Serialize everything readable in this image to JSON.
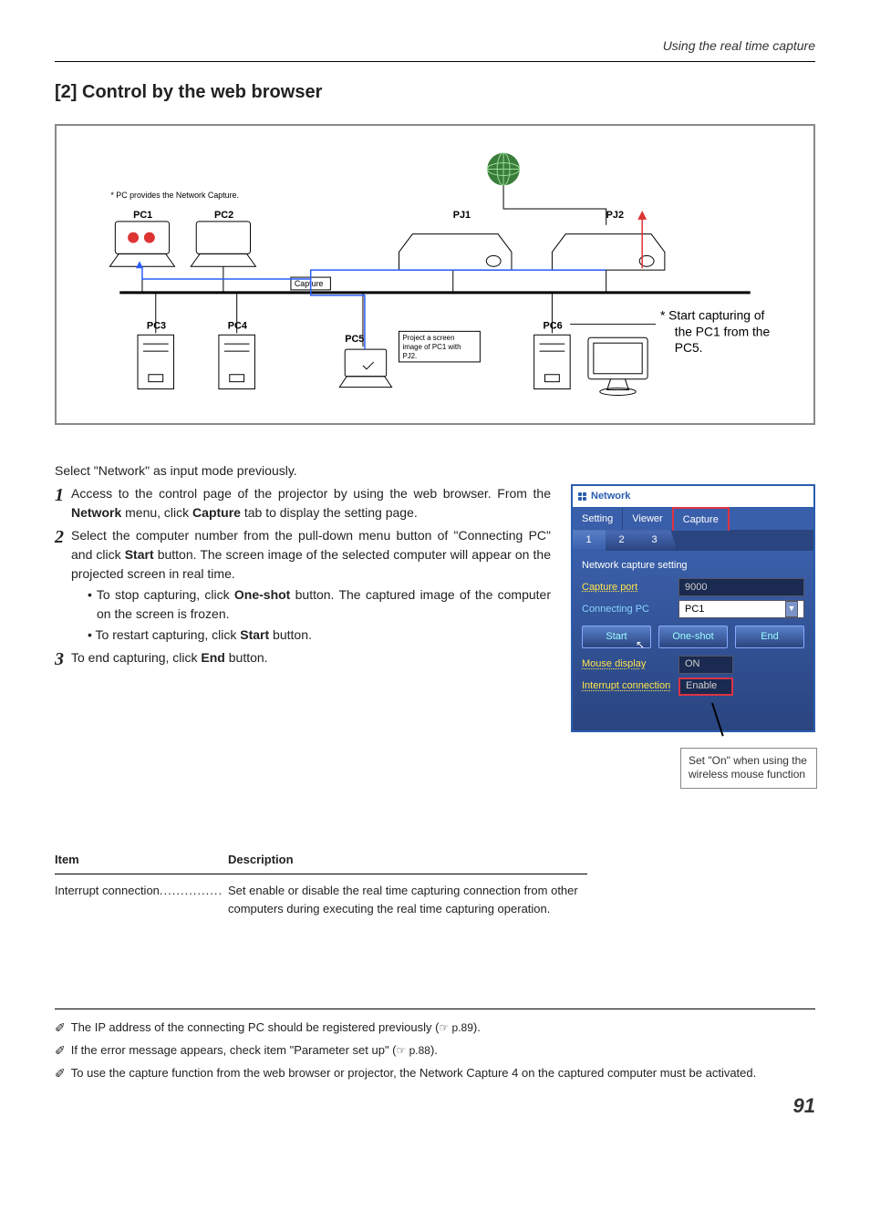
{
  "header": {
    "label": "Using the real time capture"
  },
  "title": "[2] Control by the web browser",
  "diagram": {
    "pc_caption": "* PC provides the Network Capture.",
    "labels": {
      "pc1": "PC1",
      "pc2": "PC2",
      "pc3": "PC3",
      "pc4": "PC4",
      "pc5": "PC5",
      "pc6": "PC6",
      "pj1": "PJ1",
      "pj2": "PJ2",
      "capture": "Capture",
      "proj_note": "Project a screen image of PC1 with PJ2."
    },
    "side_note": "* Start capturing of the PC1 from the PC5."
  },
  "intro": "Select \"Network\" as input mode previously.",
  "steps": {
    "s1": {
      "num": "1",
      "pre": "Access to the control page of the projector by using the web browser. From the ",
      "b1": "Network",
      "mid": " menu, click ",
      "b2": "Capture",
      "post": " tab to display the setting page."
    },
    "s2": {
      "num": "2",
      "pre": "Select the computer number from the pull-down menu button of \"Connecting PC\" and click ",
      "b1": "Start",
      "post": " button. The screen image of the selected computer will appear on the projected screen in real time."
    },
    "s2a": {
      "pre": "• To stop capturing, click ",
      "b1": "One-shot",
      "post": " button. The captured image of the computer on the screen is frozen."
    },
    "s2b": {
      "pre": "• To restart capturing, click ",
      "b1": "Start",
      "post": " button."
    },
    "s3": {
      "num": "3",
      "pre": "To end capturing, click ",
      "b1": "End",
      "post": " button."
    }
  },
  "screenshot": {
    "title": "Network",
    "tabs": {
      "setting": "Setting",
      "viewer": "Viewer",
      "capture": "Capture"
    },
    "subtabs": [
      "1",
      "2",
      "3"
    ],
    "panel_title": "Network capture setting",
    "rows": {
      "port": {
        "label": "Capture port",
        "value": "9000"
      },
      "pc": {
        "label": "Connecting PC",
        "value": "PC1"
      },
      "mouse": {
        "label": "Mouse display",
        "value": "ON"
      },
      "intc": {
        "label": "Interrupt connection",
        "value": "Enable"
      }
    },
    "buttons": {
      "start": "Start",
      "one": "One-shot",
      "end": "End"
    },
    "note": "Set \"On\" when using the wireless mouse function"
  },
  "table": {
    "h1": "Item",
    "h2": "Description",
    "item": "Interrupt connection",
    "dots": "...............",
    "desc": "Set enable or disable the real time capturing connection from other computers during executing the real time capturing operation."
  },
  "footnotes": {
    "f1": {
      "text": "The IP address of the connecting PC should be registered previously (",
      "ref": "☞ p.89",
      "post": ")."
    },
    "f2": {
      "text": "If the error message appears, check item \"Parameter set up\"  (",
      "ref": "☞ p.88",
      "post": ")."
    },
    "f3": {
      "text": "To use the capture function from the web browser or projector, the Network Capture 4 on the captured computer must be activated."
    }
  },
  "page": "91"
}
